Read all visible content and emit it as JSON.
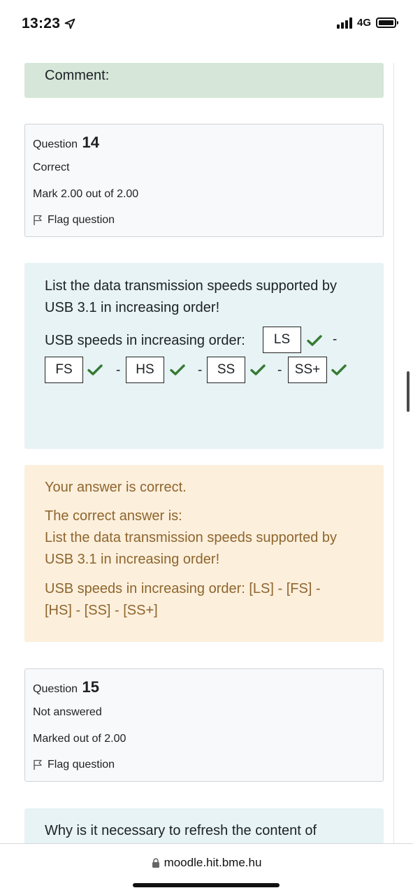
{
  "status": {
    "time": "13:23",
    "network": "4G"
  },
  "comment_section": {
    "label": "Comment:"
  },
  "question14": {
    "info": {
      "prefix": "Question",
      "number": "14",
      "state": "Correct",
      "grade": "Mark 2.00 out of 2.00",
      "flag_label": "Flag question"
    },
    "text_line1": "List the data transmission speeds supported by",
    "text_line2": "USB 3.1 in increasing order!",
    "speeds_label": "USB speeds in increasing order:",
    "separator": "-",
    "answers": [
      "LS",
      "FS",
      "HS",
      "SS",
      "SS+"
    ],
    "feedback": {
      "result": "Your answer is correct.",
      "correct_answer_label": "The correct answer is:",
      "line1": "List the data transmission speeds supported by",
      "line2": "USB 3.1 in increasing order!",
      "line3": "USB speeds in increasing order: [LS] - [FS] -",
      "line4": "[HS] - [SS] - [SS+]"
    }
  },
  "question15": {
    "info": {
      "prefix": "Question",
      "number": "15",
      "state": "Not answered",
      "grade": "Marked out of 2.00",
      "flag_label": "Flag question"
    },
    "text_line1": "Why is it necessary to refresh the content of"
  },
  "browser": {
    "url": "moodle.hit.bme.hu"
  },
  "colors": {
    "comment_bg": "#d6e6d9",
    "question_bg": "#e7f3f5",
    "feedback_bg": "#fcefdc",
    "feedback_text": "#8e662e",
    "tick": "#357a32"
  }
}
